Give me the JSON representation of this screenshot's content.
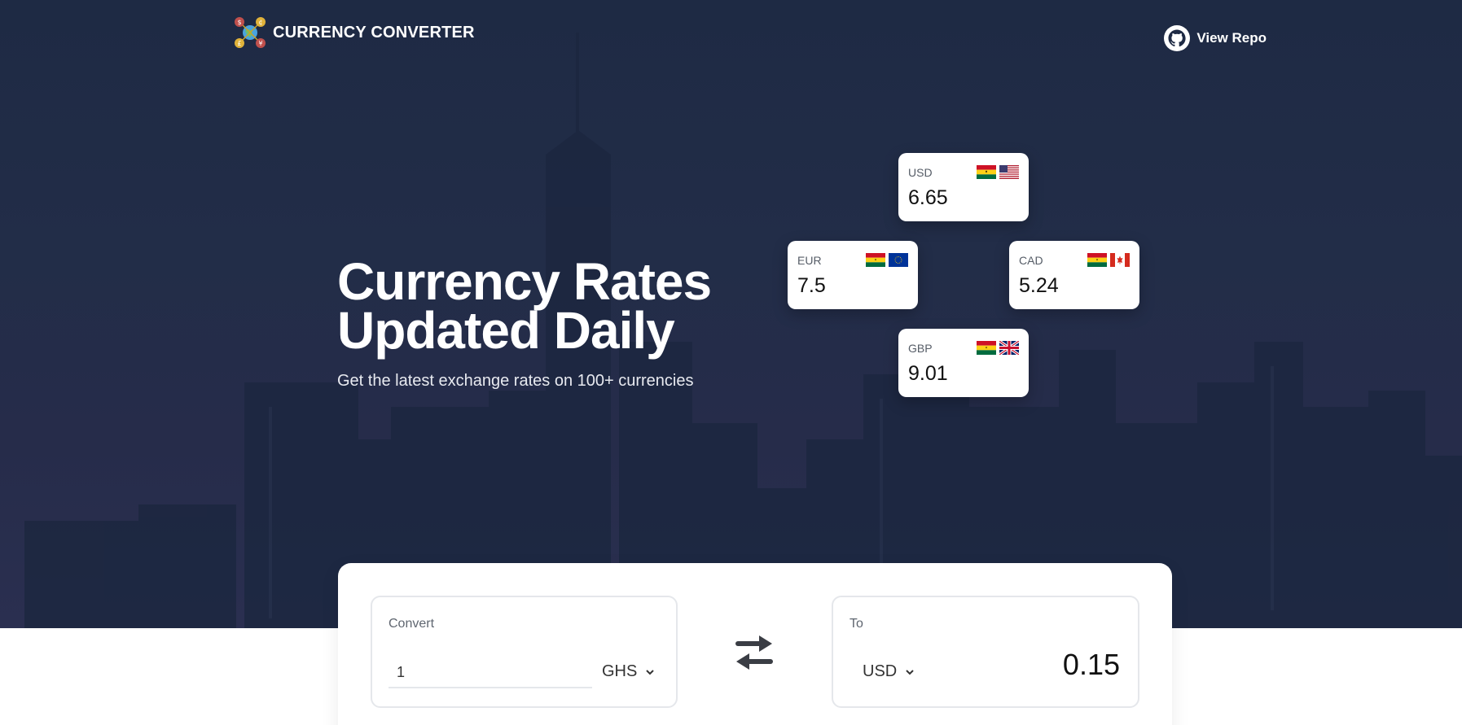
{
  "app": {
    "title": "CURRENCY CONVERTER",
    "repo_label": "View Repo"
  },
  "hero": {
    "title_line1": "Currency Rates",
    "title_line2": "Updated Daily",
    "subtitle": "Get the latest exchange rates on 100+ currencies"
  },
  "rates": [
    {
      "code": "USD",
      "value": "6.65",
      "flags": [
        "ghana-flag",
        "usa-flag"
      ]
    },
    {
      "code": "EUR",
      "value": "7.5",
      "flags": [
        "ghana-flag",
        "eu-flag"
      ]
    },
    {
      "code": "CAD",
      "value": "5.24",
      "flags": [
        "ghana-flag",
        "canada-flag"
      ]
    },
    {
      "code": "GBP",
      "value": "9.01",
      "flags": [
        "ghana-flag",
        "uk-flag"
      ]
    }
  ],
  "converter": {
    "from_label": "Convert",
    "amount_value": "1",
    "from_currency": "GHS",
    "to_label": "To",
    "to_currency": "USD",
    "result": "0.15"
  },
  "colors": {
    "hero_bg": "#222d48",
    "panel_bg": "#ffffff",
    "border": "#e5e7eb"
  },
  "icons": {
    "logo": "currency-globe-icon",
    "repo": "github-icon",
    "swap": "swap-arrows-icon",
    "chevron": "chevron-down-icon"
  }
}
